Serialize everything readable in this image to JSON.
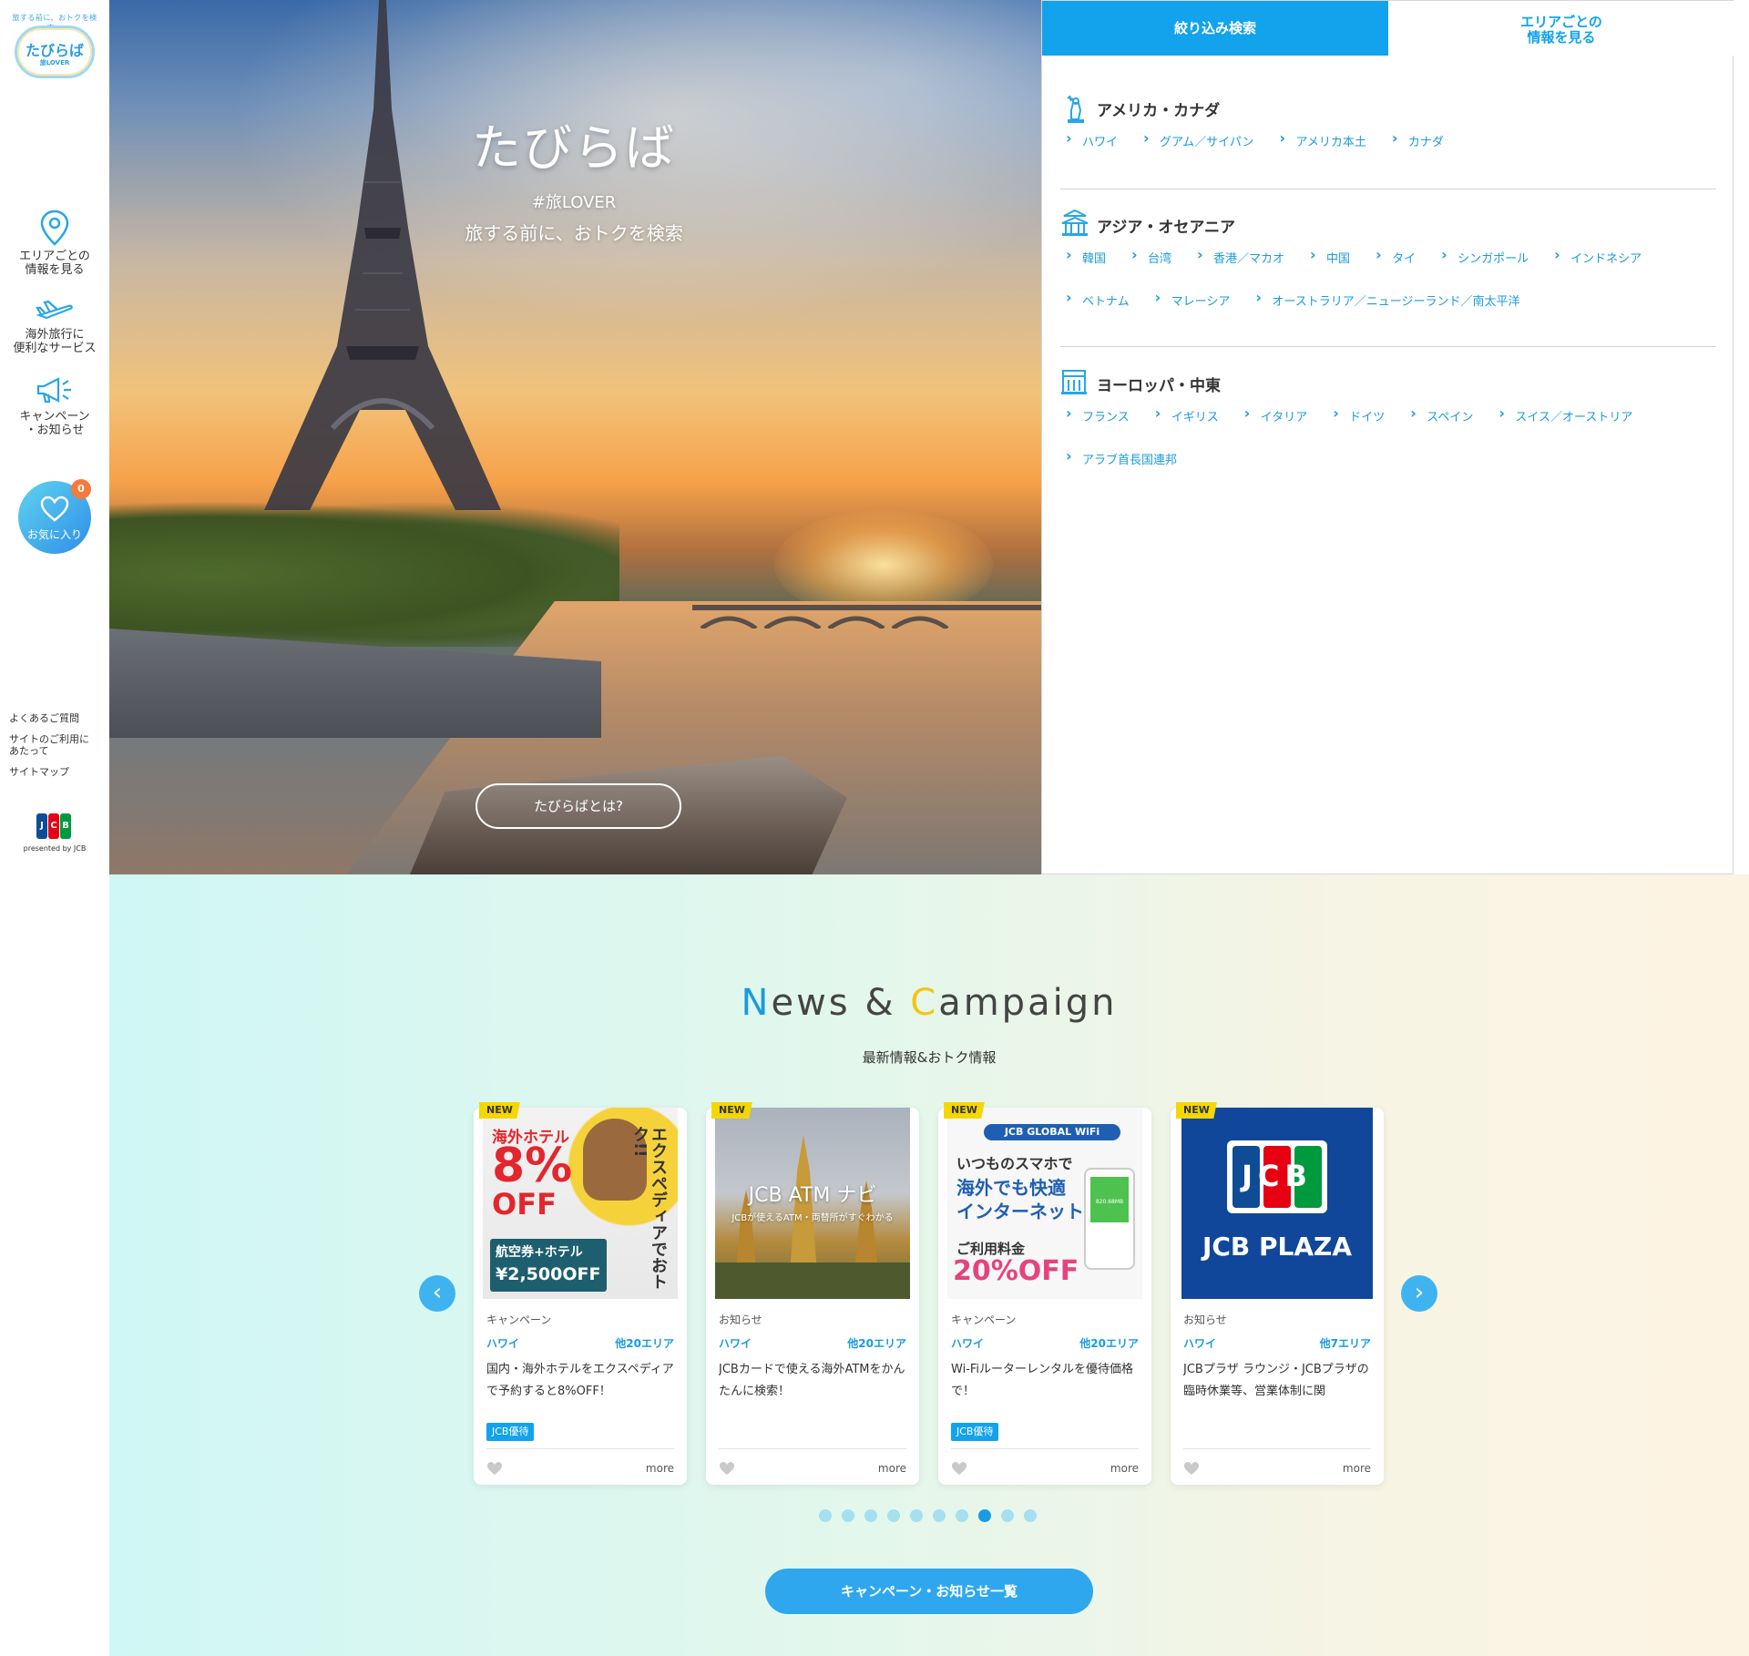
{
  "sidebar": {
    "logo": {
      "tagline": "旅する前に、おトクを検索。",
      "name": "たびらば",
      "sub": "旅LOVER"
    },
    "nav": [
      {
        "label": "エリアごとの\n情報を見る",
        "icon": "map-pin-icon"
      },
      {
        "label": "海外旅行に\n便利なサービス",
        "icon": "airplane-icon"
      },
      {
        "label": "キャンペーン\n・お知らせ",
        "icon": "megaphone-icon"
      }
    ],
    "favorite": {
      "label": "お気に入り",
      "count": "0",
      "icon": "heart-icon"
    },
    "footer_links": [
      "よくあるご質問",
      "サイトのご利用に\nあたって",
      "サイトマップ"
    ],
    "presented": "presented by JCB",
    "jcb_letters": [
      "J",
      "C",
      "B"
    ]
  },
  "hero": {
    "title": "たびらば",
    "hashtag": "#旅LOVER",
    "subtitle": "旅する前に、おトクを検索",
    "button": "たびらばとは?"
  },
  "panel": {
    "tabs": {
      "filter": "絞り込み検索",
      "area": "エリアごとの\n情報を見る"
    },
    "regions": [
      {
        "name": "アメリカ・カナダ",
        "icon": "statue-of-liberty-icon",
        "links": [
          "ハワイ",
          "グアム／サイパン",
          "アメリカ本土",
          "カナダ"
        ]
      },
      {
        "name": "アジア・オセアニア",
        "icon": "asian-temple-icon",
        "links": [
          "韓国",
          "台湾",
          "香港／マカオ",
          "中国",
          "タイ",
          "シンガポール",
          "インドネシア",
          "ベトナム",
          "マレーシア",
          "オーストラリア／ニュージーランド／南太平洋"
        ]
      },
      {
        "name": "ヨーロッパ・中東",
        "icon": "european-building-icon",
        "links": [
          "フランス",
          "イギリス",
          "イタリア",
          "ドイツ",
          "スペイン",
          "スイス／オーストリア",
          "アラブ首長国連邦"
        ]
      }
    ]
  },
  "news": {
    "title_parts": [
      "N",
      "ews & ",
      "C",
      "ampaign"
    ],
    "subtitle": "最新情報&おトク情報",
    "new_badge": "NEW",
    "more_label": "more",
    "cards": [
      {
        "category": "キャンペーン",
        "area": "ハワイ",
        "others": "他20エリア",
        "text": "国内・海外ホテルをエクスペディアで予約すると8%OFF！",
        "tag": "JCB優待",
        "thumb": {
          "l1": "海外ホテル",
          "l2": "8%",
          "l3": "OFF",
          "l4": "エクスペディアでおトク!!",
          "l5": "航空券+ホテル",
          "l6": "¥2,500OFF"
        }
      },
      {
        "category": "お知らせ",
        "area": "ハワイ",
        "others": "他20エリア",
        "text": "JCBカードで使える海外ATMをかんたんに検索！",
        "tag": "",
        "thumb": {
          "l1": "JCB ATM ナビ",
          "l2": "JCBが使えるATM・両替所がすぐわかる"
        }
      },
      {
        "category": "キャンペーン",
        "area": "ハワイ",
        "others": "他20エリア",
        "text": "Wi-Fiルーターレンタルを優待価格で！",
        "tag": "JCB優待",
        "thumb": {
          "l1": "JCB GLOBAL WiFi",
          "l2": "いつものスマホで",
          "l3": "海外でも快適",
          "l4": "インターネット",
          "l5": "ご利用料金",
          "l6": "20%OFF",
          "l7": "820.68MB"
        }
      },
      {
        "category": "お知らせ",
        "area": "ハワイ",
        "others": "他7エリア",
        "text": "JCBプラザ ラウンジ・JCBプラザの臨時休業等、営業体制に関",
        "tag": "",
        "thumb": {
          "l1": "JCB",
          "l2": "JCB PLAZA"
        }
      }
    ],
    "dots_total": 10,
    "dots_active_index": 7,
    "list_button": "キャンペーン・お知らせ一覧"
  },
  "colors": {
    "accent": "#12a3ec",
    "orange_badge": "#f47a3d",
    "new_badge": "#f4d700",
    "jcb_blue": "#0e4c96",
    "jcb_red": "#e60012",
    "jcb_green": "#009a3e"
  }
}
